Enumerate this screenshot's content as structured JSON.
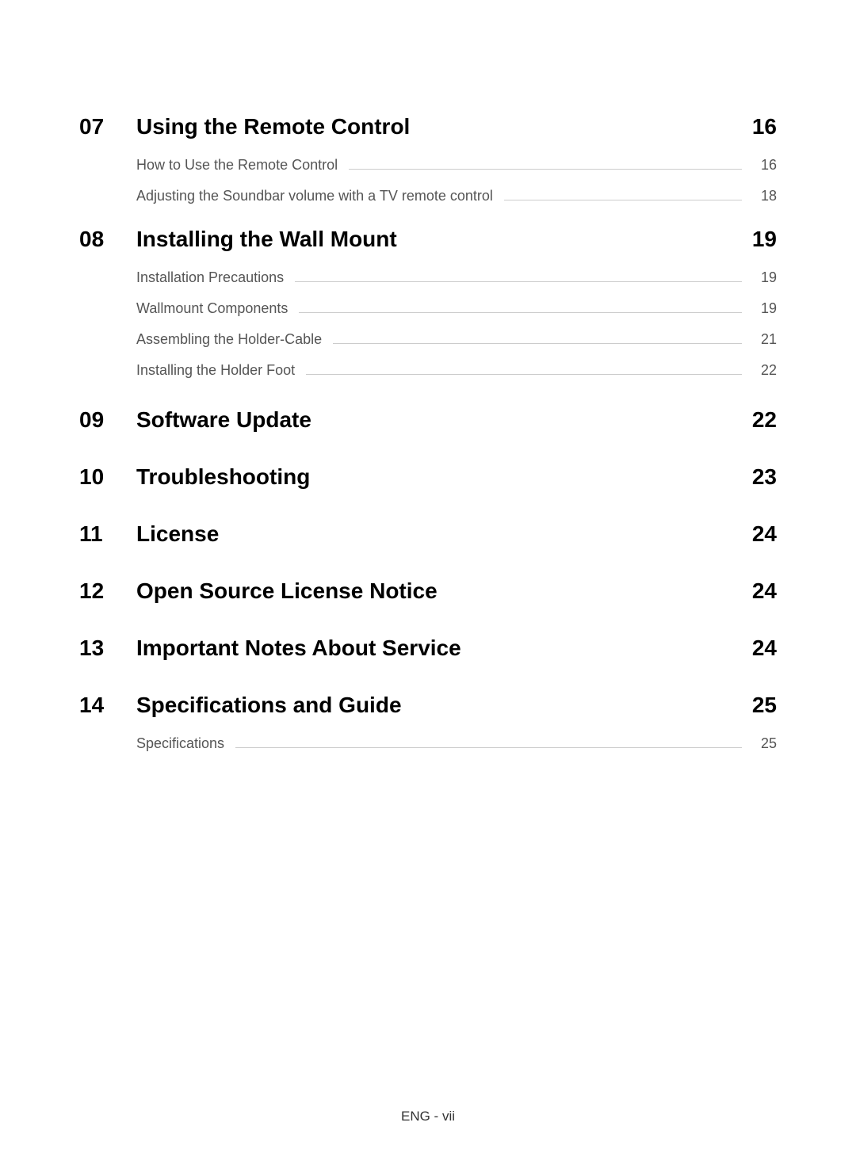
{
  "sections": [
    {
      "number": "07",
      "title": "Using the Remote Control",
      "page": "16",
      "subs": [
        {
          "title": "How to Use the Remote Control",
          "page": "16"
        },
        {
          "title": "Adjusting the Soundbar volume with a TV remote control",
          "page": "18"
        }
      ]
    },
    {
      "number": "08",
      "title": "Installing the Wall Mount",
      "page": "19",
      "subs": [
        {
          "title": "Installation Precautions",
          "page": "19"
        },
        {
          "title": "Wallmount Components",
          "page": "19"
        },
        {
          "title": "Assembling the Holder-Cable",
          "page": "21"
        },
        {
          "title": "Installing the Holder Foot",
          "page": "22"
        }
      ]
    },
    {
      "number": "09",
      "title": "Software Update",
      "page": "22",
      "subs": []
    },
    {
      "number": "10",
      "title": "Troubleshooting",
      "page": "23",
      "subs": []
    },
    {
      "number": "11",
      "title": "License",
      "page": "24",
      "subs": []
    },
    {
      "number": "12",
      "title": "Open Source License Notice",
      "page": "24",
      "subs": []
    },
    {
      "number": "13",
      "title": "Important Notes About Service",
      "page": "24",
      "subs": []
    },
    {
      "number": "14",
      "title": "Specifications and Guide",
      "page": "25",
      "subs": [
        {
          "title": "Specifications",
          "page": "25"
        }
      ]
    }
  ],
  "footer": "ENG - vii"
}
